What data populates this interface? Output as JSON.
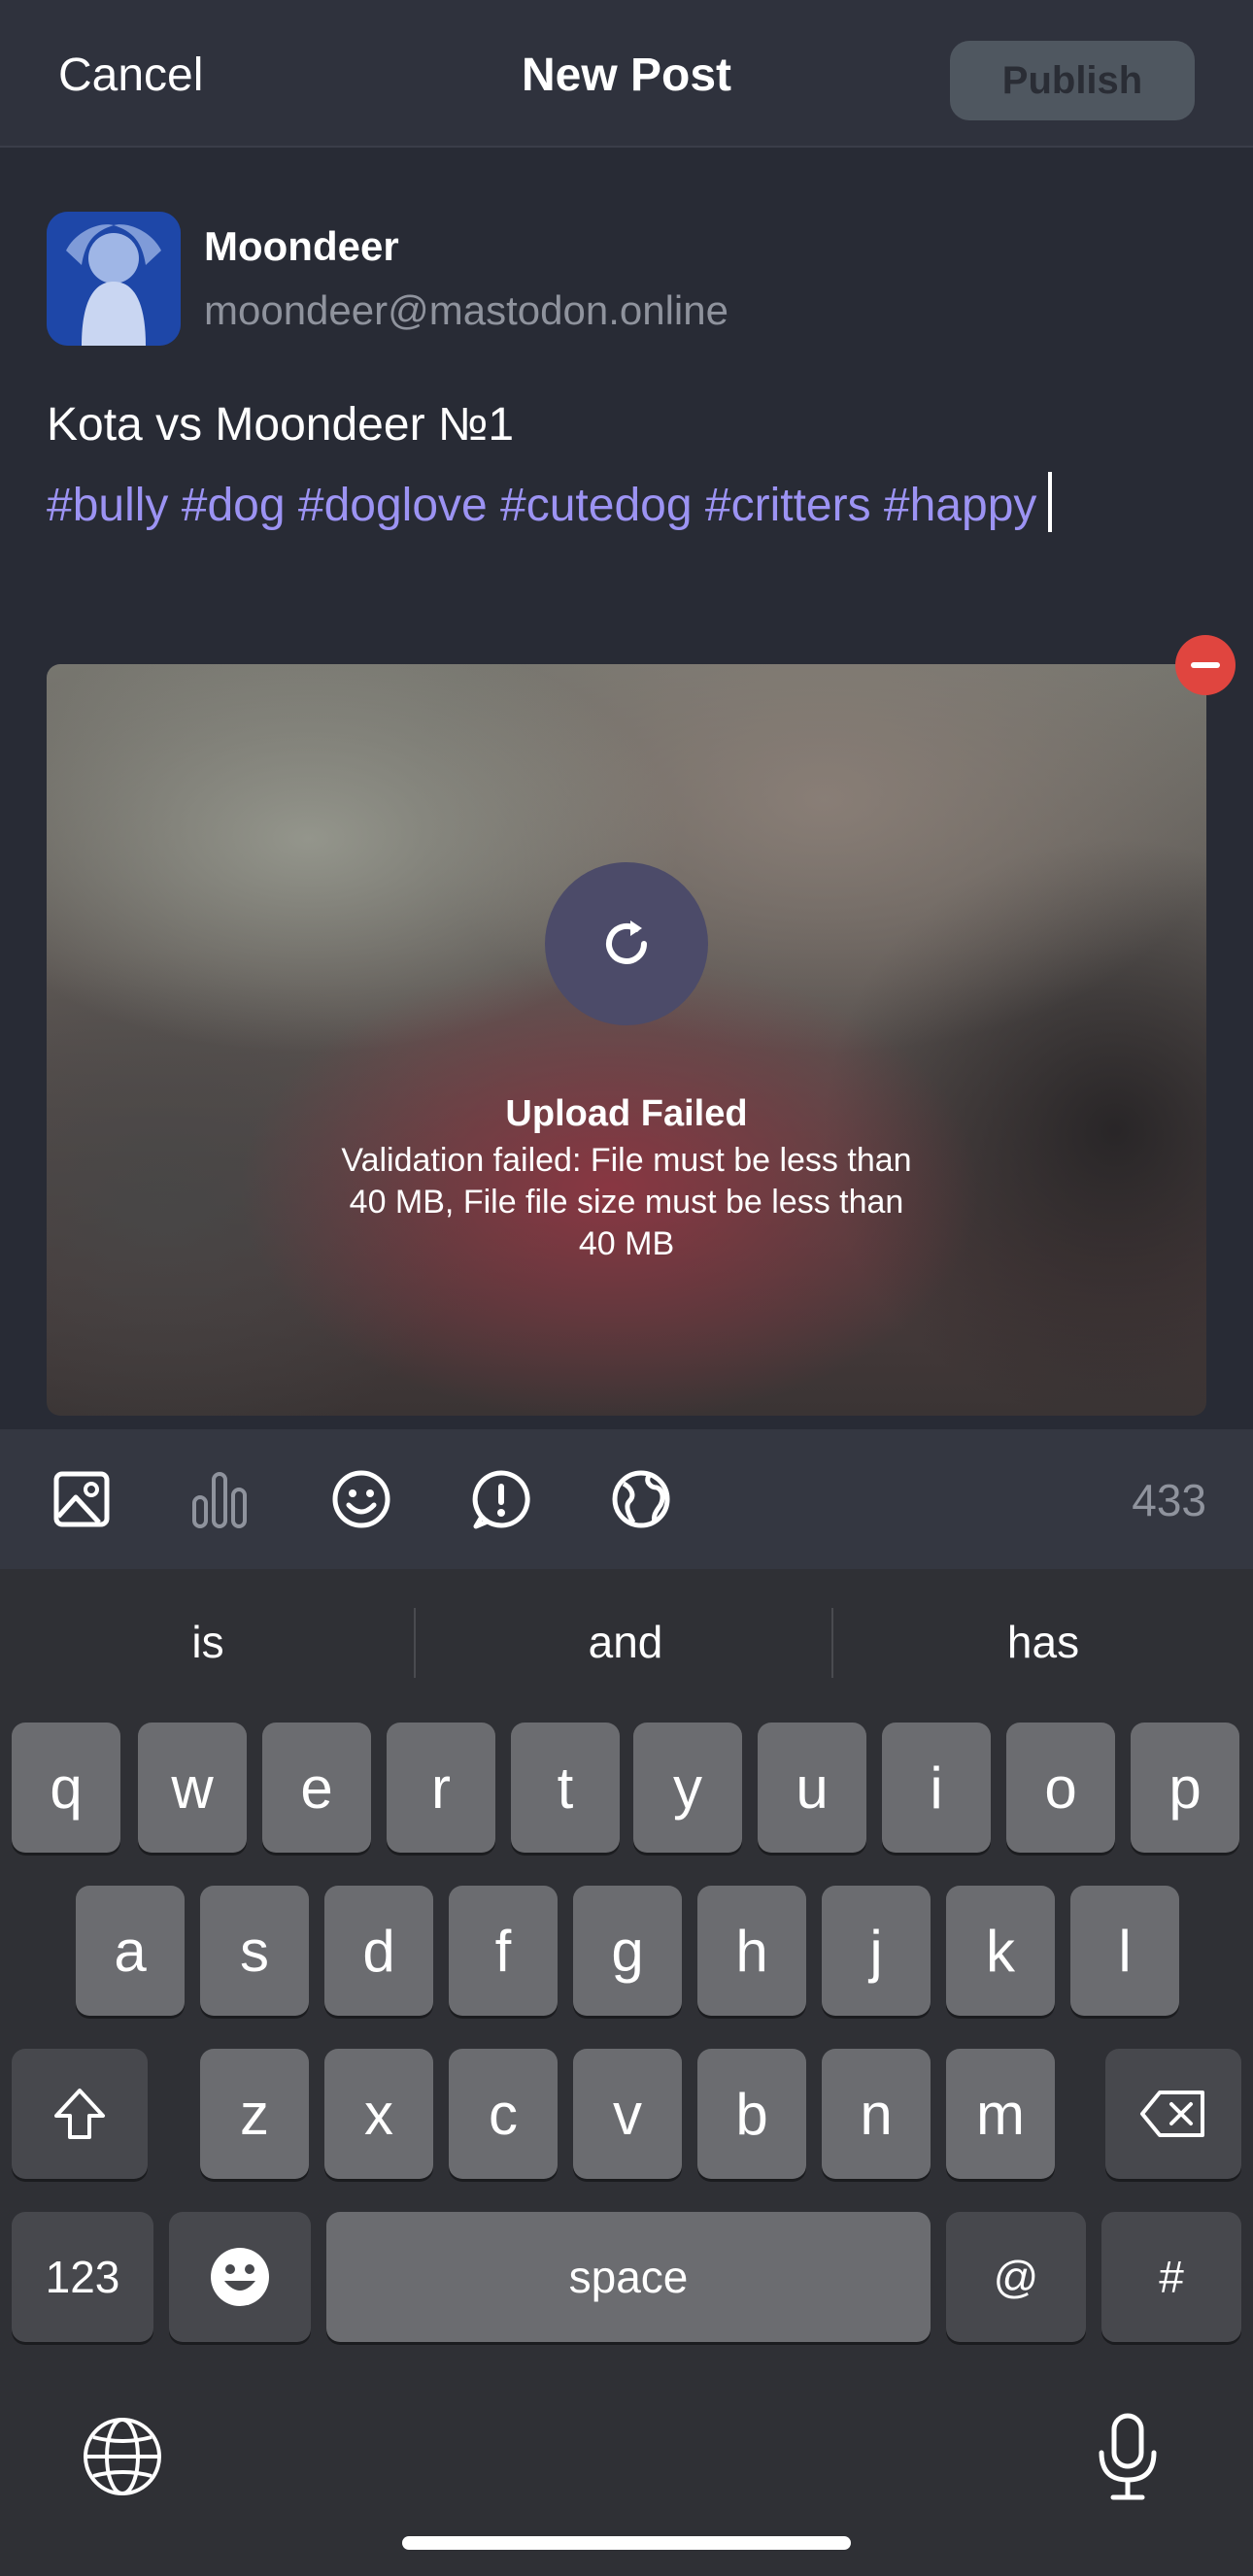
{
  "header": {
    "cancel_label": "Cancel",
    "title": "New Post",
    "publish_label": "Publish"
  },
  "account": {
    "display_name": "Moondeer",
    "handle": "moondeer@mastodon.online",
    "avatar_icon": "avatar-image"
  },
  "post": {
    "title_line": "Kota vs Moondeer №1",
    "tags_line": "#bully #dog #doglove #cutedog #critters #happy"
  },
  "attachment": {
    "status_title": "Upload Failed",
    "status_message": "Validation failed: File must be less than 40 MB, File file size must be less than 40 MB",
    "retry_icon": "retry-icon",
    "remove_icon": "remove-icon"
  },
  "toolbar": {
    "icons": [
      "image-icon",
      "poll-icon",
      "emoji-icon",
      "content-warning-icon",
      "globe-icon"
    ],
    "char_count": "433"
  },
  "keyboard": {
    "suggestions": [
      "is",
      "and",
      "has"
    ],
    "row1": [
      "q",
      "w",
      "e",
      "r",
      "t",
      "y",
      "u",
      "i",
      "o",
      "p"
    ],
    "row2": [
      "a",
      "s",
      "d",
      "f",
      "g",
      "h",
      "j",
      "k",
      "l"
    ],
    "row3": [
      "z",
      "x",
      "c",
      "v",
      "b",
      "n",
      "m"
    ],
    "numbers_label": "123",
    "space_label": "space",
    "at_label": "@",
    "hash_label": "#"
  },
  "colors": {
    "hashtag": "#9c93f3",
    "background": "#282b35",
    "remove": "#e0453f",
    "publish_disabled": "#4f5760"
  }
}
